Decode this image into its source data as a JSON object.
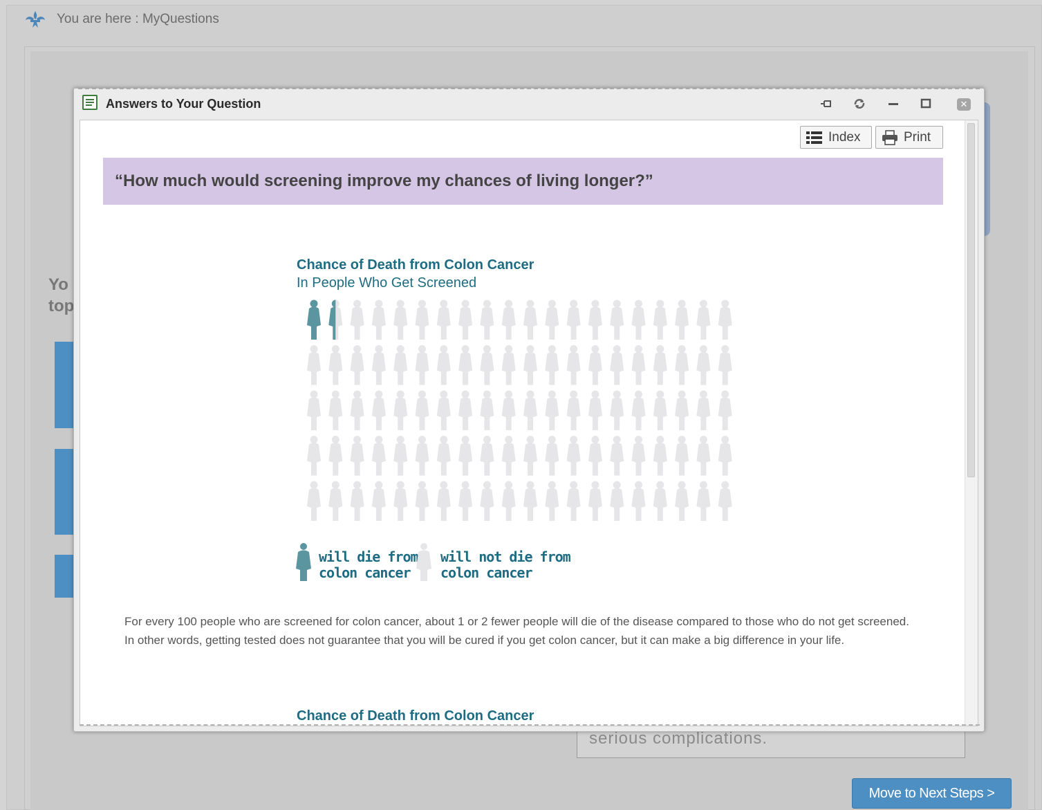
{
  "breadcrumb": {
    "text": "You are here : MyQuestions"
  },
  "background": {
    "partial_text_line1": "Yo",
    "partial_text_line2": "top",
    "callout_text": "serious complications.",
    "next_button": "Move to Next Steps >"
  },
  "modal": {
    "title": "Answers to Your Question",
    "controls": [
      "pin-icon",
      "refresh-icon",
      "minimize-icon",
      "maximize-icon",
      "close-icon"
    ],
    "toolbar": {
      "index_label": "Index",
      "print_label": "Print"
    },
    "question": "“How much would screening improve my chances of living longer?”",
    "chart": {
      "title": "Chance of Death from Colon Cancer",
      "subtitle": "In People Who Get Screened",
      "legend_die": [
        "will die from",
        "colon cancer"
      ],
      "legend_not_die": [
        "will not die from",
        "colon cancer"
      ]
    },
    "paragraph": "For every 100 people who are screened for colon cancer, about 1 or 2 fewer people will die of the disease compared to those who do not get screened. In other words, getting tested does not guarantee that you will be cured if you get colon cancer, but it can make a big difference in your life.",
    "next_chart_title": "Chance of Death from Colon Cancer"
  },
  "chart_data": {
    "type": "icon-array",
    "title": "Chance of Death from Colon Cancer",
    "subtitle": "In People Who Get Screened",
    "total": 100,
    "rows": 5,
    "columns": 20,
    "die_count": 1.5,
    "legend": [
      "will die from colon cancer",
      "will not die from colon cancer"
    ],
    "colors": {
      "die": "#5b959f",
      "not_die": "#e6e6e8"
    }
  },
  "colors": {
    "accent_blue": "#4d8fc3",
    "question_band": "#d6c6e6",
    "chart_teal": "#1e6c83"
  }
}
